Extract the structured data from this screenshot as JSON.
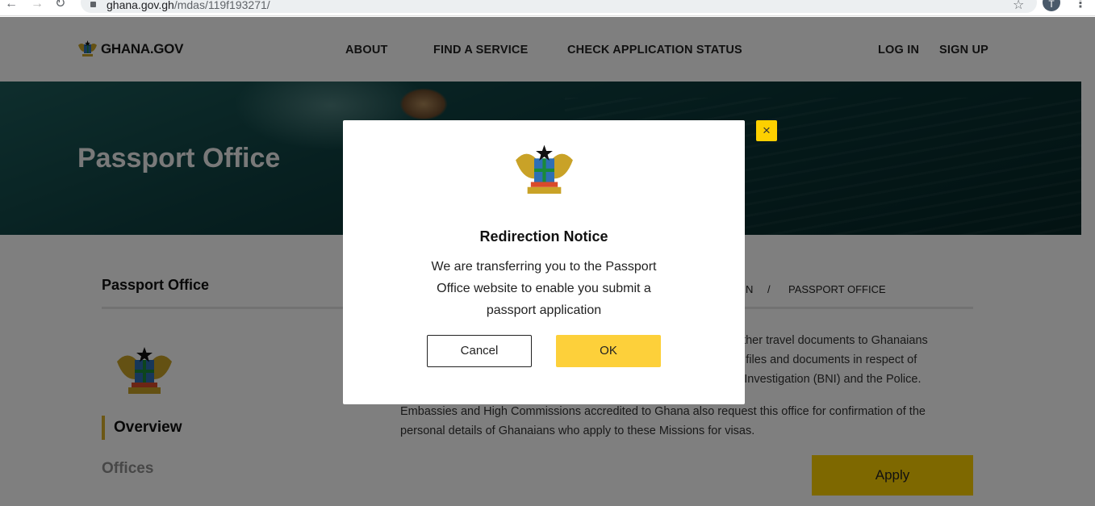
{
  "browser": {
    "url_host": "ghana.gov.gh",
    "url_path": "/mdas/119f193271/",
    "back_icon": "arrow-left-icon",
    "forward_icon": "arrow-right-icon",
    "reload_icon": "reload-icon",
    "bookmark_icon": "star-icon",
    "profile_initial": "T",
    "menu_icon": "kebab-menu-icon"
  },
  "header": {
    "logo_text": "GHANA.GOV",
    "nav": [
      "ABOUT",
      "FIND A SERVICE",
      "CHECK APPLICATION STATUS"
    ],
    "auth": [
      "LOG IN",
      "SIGN UP"
    ]
  },
  "hero": {
    "title": "Passport Office"
  },
  "sidebar": {
    "title": "Passport Office",
    "items": [
      {
        "label": "Overview"
      },
      {
        "label": "Offices"
      }
    ]
  },
  "breadcrumb": {
    "partial": "N",
    "separator": "/",
    "current": "PASSPORT OFFICE"
  },
  "content": {
    "lines_visible": [
      "other travel documents to Ghanaians",
      "s files and documents in respect of",
      "l Investigation (BNI) and the Police.",
      "Embassies and High Commissions accredited to Ghana also request this office for confirmation of the",
      "personal details of Ghanaians who apply to these Missions for visas."
    ],
    "apply_label": "Apply"
  },
  "modal": {
    "title": "Redirection Notice",
    "message": "We are transferring you to the Passport Office website to enable you submit a passport application",
    "cancel_label": "Cancel",
    "ok_label": "OK",
    "close_glyph": "×"
  },
  "colors": {
    "accent_yellow": "#fdd000",
    "overview_marker": "#d9ae2b",
    "hero_dark": "#093233"
  }
}
